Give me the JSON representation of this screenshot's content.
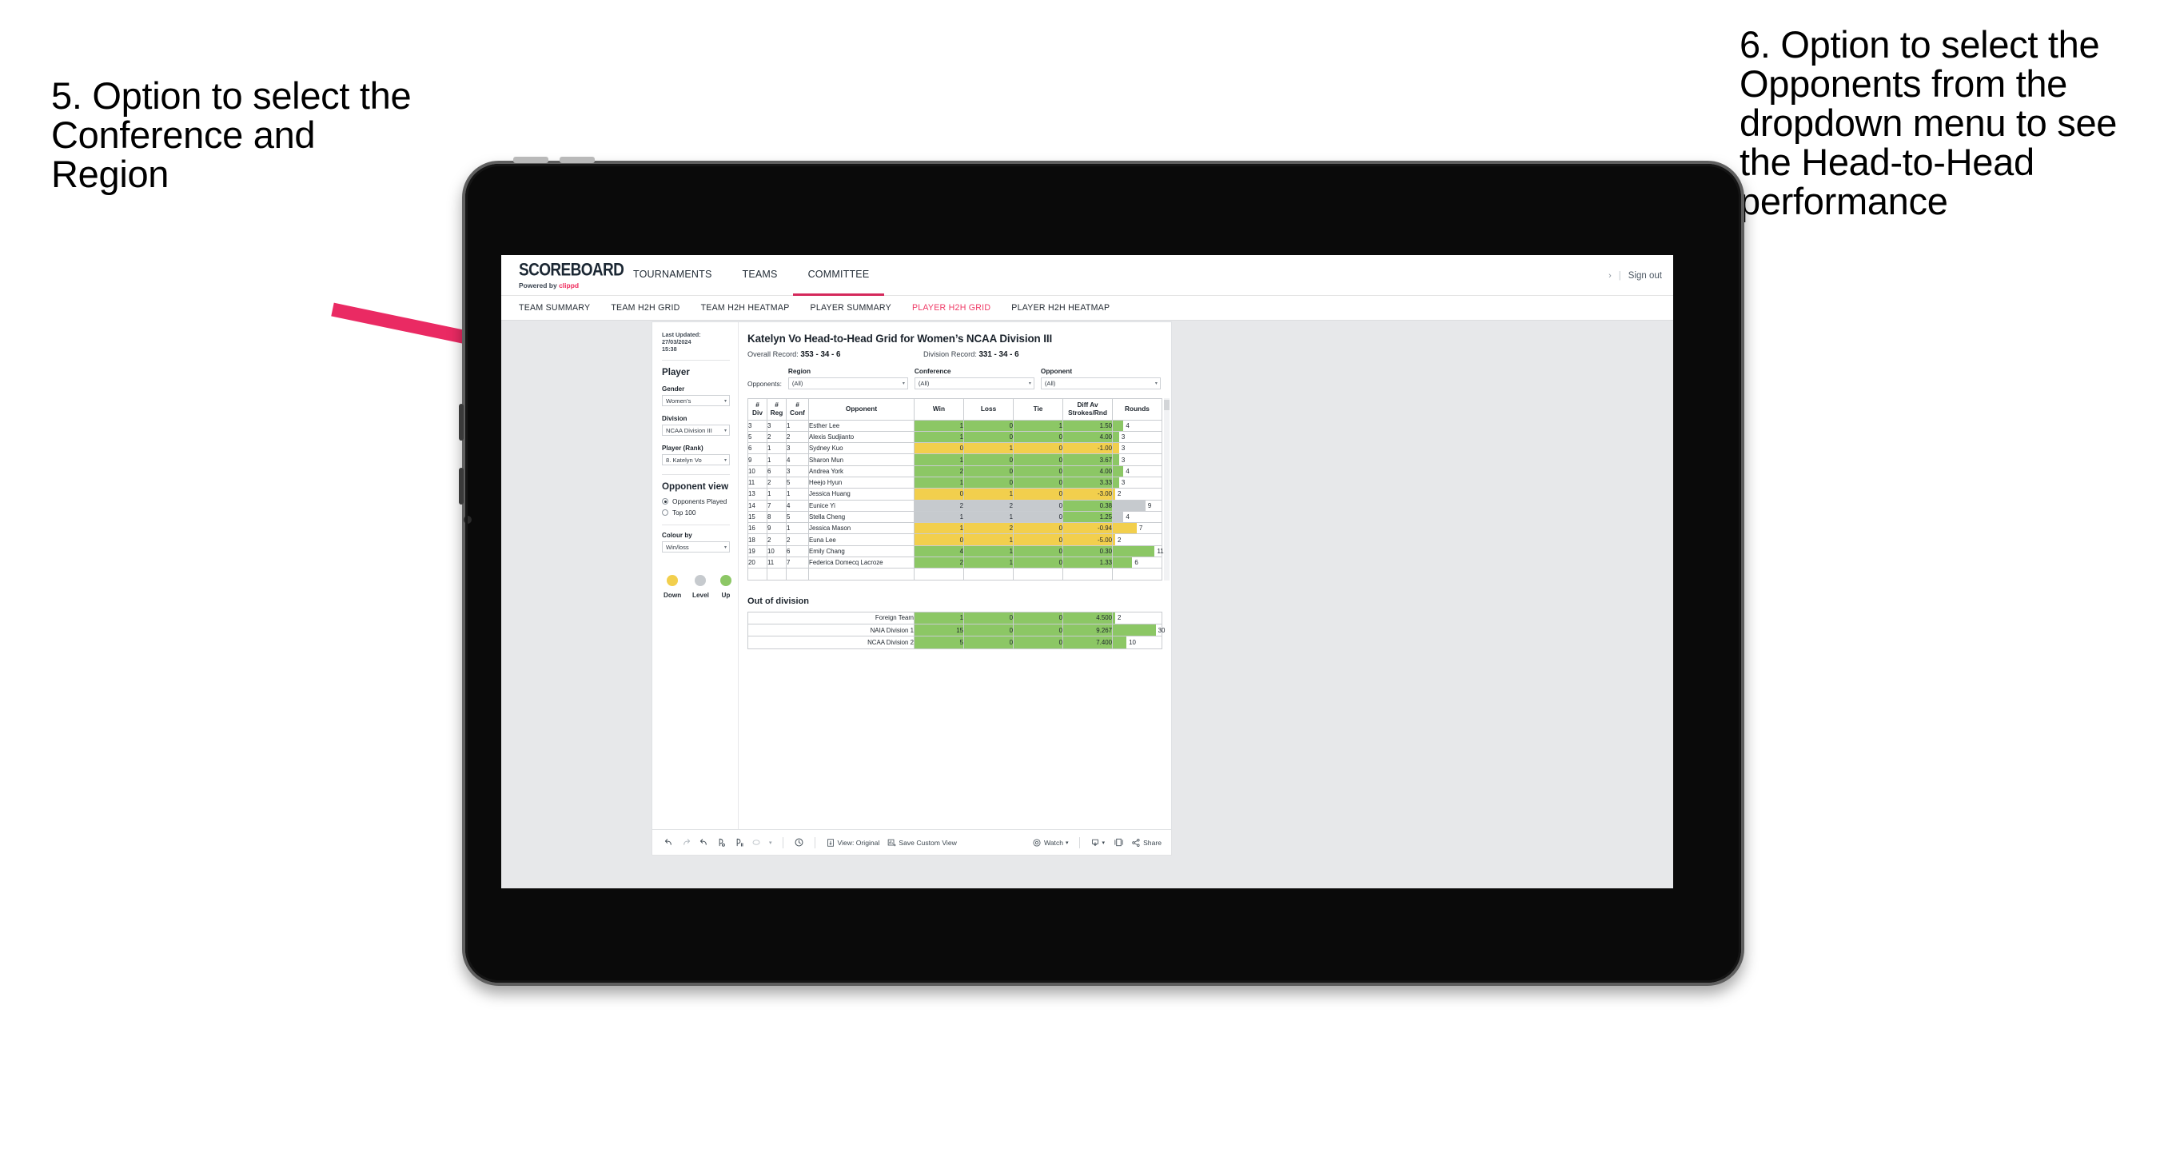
{
  "annotations": {
    "left": "5. Option to select the Conference and Region",
    "right": "6. Option to select the Opponents from the dropdown menu to see the Head-to-Head performance",
    "arrow_color": "#ea2a63"
  },
  "app": {
    "logo": {
      "main": "SCOREBOARD",
      "powered": "Powered by ",
      "brand": "clippd"
    },
    "topnav": [
      {
        "label": "TOURNAMENTS",
        "active": false
      },
      {
        "label": "TEAMS",
        "active": false
      },
      {
        "label": "COMMITTEE",
        "active": true
      }
    ],
    "appbar_right": {
      "chevron": "›",
      "separator": "|",
      "signout": "Sign out"
    },
    "subnav": [
      {
        "label": "TEAM SUMMARY",
        "active": false
      },
      {
        "label": "TEAM H2H GRID",
        "active": false
      },
      {
        "label": "TEAM H2H HEATMAP",
        "active": false
      },
      {
        "label": "PLAYER SUMMARY",
        "active": false
      },
      {
        "label": "PLAYER H2H GRID",
        "active": true
      },
      {
        "label": "PLAYER H2H HEATMAP",
        "active": false
      }
    ],
    "accent": "#ef3a66"
  },
  "filters": {
    "last_updated_label": "Last Updated: ",
    "last_updated_value": "27/03/2024",
    "last_updated_time": "15:38",
    "player_heading": "Player",
    "gender": {
      "label": "Gender",
      "value": "Women’s"
    },
    "division": {
      "label": "Division",
      "value": "NCAA Division III"
    },
    "player_rank": {
      "label": "Player (Rank)",
      "value": "8. Katelyn Vo"
    },
    "opponent_view": {
      "heading": "Opponent view",
      "options": [
        {
          "label": "Opponents Played",
          "selected": true
        },
        {
          "label": "Top 100",
          "selected": false
        }
      ]
    },
    "colour_by": {
      "label": "Colour by",
      "value": "Win/loss"
    },
    "legend": [
      {
        "label": "Down",
        "color": "#f2cf4d"
      },
      {
        "label": "Level",
        "color": "#c6cace"
      },
      {
        "label": "Up",
        "color": "#8cc765"
      }
    ]
  },
  "grid": {
    "title": "Katelyn Vo Head-to-Head Grid for Women’s NCAA Division III",
    "overall_label": "Overall Record: ",
    "overall_value": "353 - 34 - 6",
    "division_label": "Division Record: ",
    "division_value": "331 - 34 - 6",
    "opponents_label": "Opponents:",
    "selects": [
      {
        "label": "Region",
        "value": "(All)"
      },
      {
        "label": "Conference",
        "value": "(All)"
      },
      {
        "label": "Opponent",
        "value": "(All)"
      }
    ],
    "headers": [
      {
        "l1": "#",
        "l2": "Div"
      },
      {
        "l1": "#",
        "l2": "Reg"
      },
      {
        "l1": "#",
        "l2": "Conf"
      },
      {
        "l1": "Opponent",
        "l2": ""
      },
      {
        "l1": "Win",
        "l2": ""
      },
      {
        "l1": "Loss",
        "l2": ""
      },
      {
        "l1": "Tie",
        "l2": ""
      },
      {
        "l1": "Diff Av",
        "l2": "Strokes/Rnd"
      },
      {
        "l1": "Rounds",
        "l2": ""
      }
    ],
    "rows": [
      {
        "div": "3",
        "reg": "3",
        "conf": "1",
        "opponent": "Esther Lee",
        "win": "1",
        "loss": "0",
        "tie": "1",
        "diff": "1.50",
        "rounds": "4",
        "bar_pct": 22,
        "color": "#8cc765"
      },
      {
        "div": "5",
        "reg": "2",
        "conf": "2",
        "opponent": "Alexis Sudjianto",
        "win": "1",
        "loss": "0",
        "tie": "0",
        "diff": "4.00",
        "rounds": "3",
        "bar_pct": 13,
        "color": "#8cc765"
      },
      {
        "div": "6",
        "reg": "1",
        "conf": "3",
        "opponent": "Sydney Kuo",
        "win": "0",
        "loss": "1",
        "tie": "0",
        "diff": "-1.00",
        "rounds": "3",
        "bar_pct": 13,
        "color": "#f2cf4d"
      },
      {
        "div": "9",
        "reg": "1",
        "conf": "4",
        "opponent": "Sharon Mun",
        "win": "1",
        "loss": "0",
        "tie": "0",
        "diff": "3.67",
        "rounds": "3",
        "bar_pct": 13,
        "color": "#8cc765"
      },
      {
        "div": "10",
        "reg": "6",
        "conf": "3",
        "opponent": "Andrea York",
        "win": "2",
        "loss": "0",
        "tie": "0",
        "diff": "4.00",
        "rounds": "4",
        "bar_pct": 22,
        "color": "#8cc765"
      },
      {
        "div": "11",
        "reg": "2",
        "conf": "5",
        "opponent": "Heejo Hyun",
        "win": "1",
        "loss": "0",
        "tie": "0",
        "diff": "3.33",
        "rounds": "3",
        "bar_pct": 13,
        "color": "#8cc765"
      },
      {
        "div": "13",
        "reg": "1",
        "conf": "1",
        "opponent": "Jessica Huang",
        "win": "0",
        "loss": "1",
        "tie": "0",
        "diff": "-3.00",
        "rounds": "2",
        "bar_pct": 5,
        "color": "#f2cf4d"
      },
      {
        "div": "14",
        "reg": "7",
        "conf": "4",
        "opponent": "Eunice Yi",
        "win": "2",
        "loss": "2",
        "tie": "0",
        "diff": "0.38",
        "rounds": "9",
        "bar_pct": 67,
        "color": "#c6cace",
        "diff_color": "#8cc765"
      },
      {
        "div": "15",
        "reg": "8",
        "conf": "5",
        "opponent": "Stella Cheng",
        "win": "1",
        "loss": "1",
        "tie": "0",
        "diff": "1.25",
        "rounds": "4",
        "bar_pct": 22,
        "color": "#c6cace",
        "diff_color": "#8cc765"
      },
      {
        "div": "16",
        "reg": "9",
        "conf": "1",
        "opponent": "Jessica Mason",
        "win": "1",
        "loss": "2",
        "tie": "0",
        "diff": "-0.94",
        "rounds": "7",
        "bar_pct": 49,
        "color": "#f2cf4d"
      },
      {
        "div": "18",
        "reg": "2",
        "conf": "2",
        "opponent": "Euna Lee",
        "win": "0",
        "loss": "1",
        "tie": "0",
        "diff": "-5.00",
        "rounds": "2",
        "bar_pct": 5,
        "color": "#f2cf4d"
      },
      {
        "div": "19",
        "reg": "10",
        "conf": "6",
        "opponent": "Emily Chang",
        "win": "4",
        "loss": "1",
        "tie": "0",
        "diff": "0.30",
        "rounds": "11",
        "bar_pct": 86,
        "color": "#8cc765"
      },
      {
        "div": "20",
        "reg": "11",
        "conf": "7",
        "opponent": "Federica Domecq Lacroze",
        "win": "2",
        "loss": "1",
        "tie": "0",
        "diff": "1.33",
        "rounds": "6",
        "bar_pct": 40,
        "color": "#8cc765"
      }
    ],
    "out_of_division": {
      "title": "Out of division",
      "rows": [
        {
          "name": "Foreign Team",
          "win": "1",
          "loss": "0",
          "tie": "0",
          "diff": "4.500",
          "rounds": "2",
          "bar_pct": 5,
          "color": "#8cc765"
        },
        {
          "name": "NAIA Division 1",
          "win": "15",
          "loss": "0",
          "tie": "0",
          "diff": "9.267",
          "rounds": "30",
          "bar_pct": 88,
          "color": "#8cc765"
        },
        {
          "name": "NCAA Division 2",
          "win": "5",
          "loss": "0",
          "tie": "0",
          "diff": "7.400",
          "rounds": "10",
          "bar_pct": 28,
          "color": "#8cc765"
        }
      ]
    }
  },
  "toolbar": {
    "view_label": "View: Original",
    "save_label": "Save Custom View",
    "watch_label": "Watch",
    "share_label": "Share",
    "caret": "▾"
  }
}
